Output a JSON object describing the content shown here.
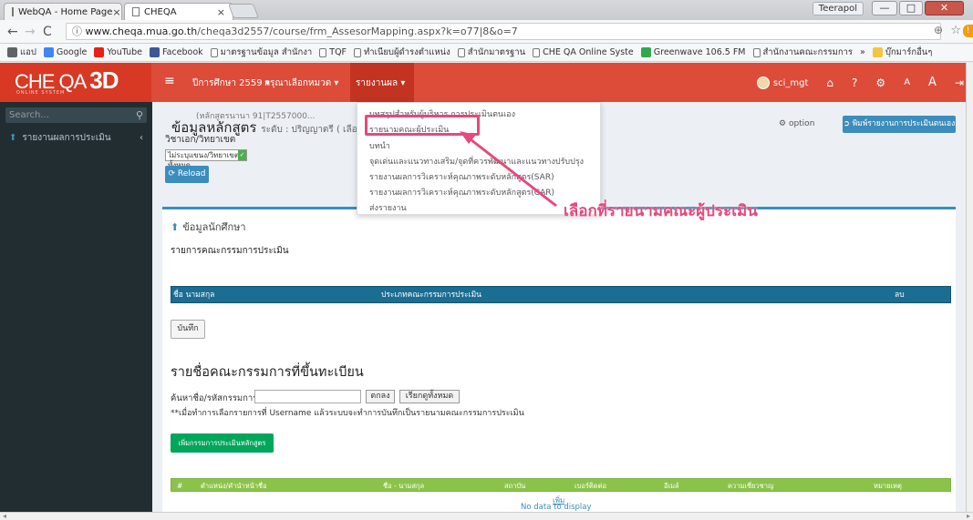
{
  "browser": {
    "tabs": [
      {
        "title": "WebQA - Home Page"
      },
      {
        "title": "CHEQA"
      }
    ],
    "user_chip": "Teerapol",
    "url_host": "www.cheqa.mua.go.th",
    "url_path": "/cheqa3d2557/course/frm_AssesorMapping.aspx?k=o77|8&o=7",
    "bookmarks": [
      {
        "label": "แอป",
        "icon": "apps-icon",
        "color": "#5f6368"
      },
      {
        "label": "Google",
        "icon": "google-icon",
        "color": "#4285f4"
      },
      {
        "label": "YouTube",
        "icon": "youtube-icon",
        "color": "#e62117"
      },
      {
        "label": "Facebook",
        "icon": "facebook-icon",
        "color": "#3b5998"
      },
      {
        "label": "มาตรฐานข้อมูล สำนักงา",
        "icon": "page-icon"
      },
      {
        "label": "TQF",
        "icon": "page-icon"
      },
      {
        "label": "ทำเนียบผู้ดำรงตำแหน่ง",
        "icon": "page-icon"
      },
      {
        "label": "สำนักมาตรฐาน",
        "icon": "page-icon"
      },
      {
        "label": "CHE QA Online Syste",
        "icon": "page-icon"
      },
      {
        "label": "Greenwave 106.5 FM",
        "icon": "radio-icon",
        "color": "#2eaa4a"
      },
      {
        "label": "สำนักงานคณะกรรมการ",
        "icon": "page-icon"
      },
      {
        "label": "»",
        "icon": ""
      },
      {
        "label": "บุ๊กมาร์กอื่นๆ",
        "icon": "folder-icon",
        "color": "#f4c542"
      }
    ]
  },
  "app": {
    "logo_main": "CHE QA",
    "logo_3d": "3D",
    "logo_sub": "ONLINE SYSTEM",
    "menu_year": "ปีการศึกษา 2559 ▾",
    "menu_category": "กรุณาเลือกหมวด ▾",
    "menu_report": "รายงานผล ▾",
    "username": "sci_mgt",
    "accent": "#dd4b39"
  },
  "sidebar": {
    "search_placeholder": "Search...",
    "item_label": "รายงานผลการประเมิน"
  },
  "content": {
    "header_top": "(หลักสูตรนานา 91|T2557000...",
    "title": "ข้อมูลหลักสูตร",
    "title_small": "ระดับ : ปริญญาตรี ( เลือกใช้...",
    "major_label": "วิชาเอก/วิทยาเขต",
    "major_select": "ไม่ระบุแขนง/วิทยาเขต/ทั้งหมด",
    "reload_label": "Reload",
    "option_label": "option",
    "print_label": "พิมพ์รายงานการประเมินตนเอง",
    "box_header": "ข้อมูลนักศึกษา",
    "section1": "รายการคณะกรรมการประเมิน",
    "table1_headers": [
      "ชื่อ นามสกุล",
      "ประเภทคณะกรรมการประเมิน",
      "ลบ"
    ],
    "save_label": "บันทึก",
    "section2": "รายชื่อคณะกรรมการที่ขึ้นทะเบียน",
    "search_label": "ค้นหาชื่อ/รหัสกรรมการ",
    "ok_label": "ตกลง",
    "all_label": "เรียกดูทั้งหมด",
    "note": "**เมื่อทำการเลือกรายการที่ Username แล้วระบบจะทำการบันทึกเป็นรายนามคณะกรรมการประเมิน",
    "add_label": "เพิ่มกรรมการประเมินหลักสูตร",
    "table2_headers": [
      "#",
      "ตำแหน่ง/คำนำหน้าชื่อ",
      "ชื่อ - นามสกุล",
      "สถาบัน",
      "เบอร์ติดต่อ",
      "อีเมล์",
      "ความเชี่ยวชาญ",
      "หมายเหตุ"
    ],
    "table2_more": "เพิ่ม",
    "no_data": "No data to display"
  },
  "dropdown": {
    "items": [
      "บทสรุปสำหรับผู้บริหาร การประเมินตนเอง",
      "รายนามคณะผู้ประเมิน",
      "บทนำ",
      "จุดเด่นและแนวทางเสริม/จุดที่ควรพัฒนาและแนวทางปรับปรุง",
      "รายงานผลการวิเคราะห์คุณภาพระดับหลักสูตร(SAR)",
      "รายงานผลการวิเคราะห์คุณภาพระดับหลักสูตร(CAR)",
      "ส่งรายงาน"
    ],
    "highlight_color": "#e8487a"
  },
  "annotation": {
    "text": "เลือกที่รายนามคณะผู้ประเมิน"
  }
}
